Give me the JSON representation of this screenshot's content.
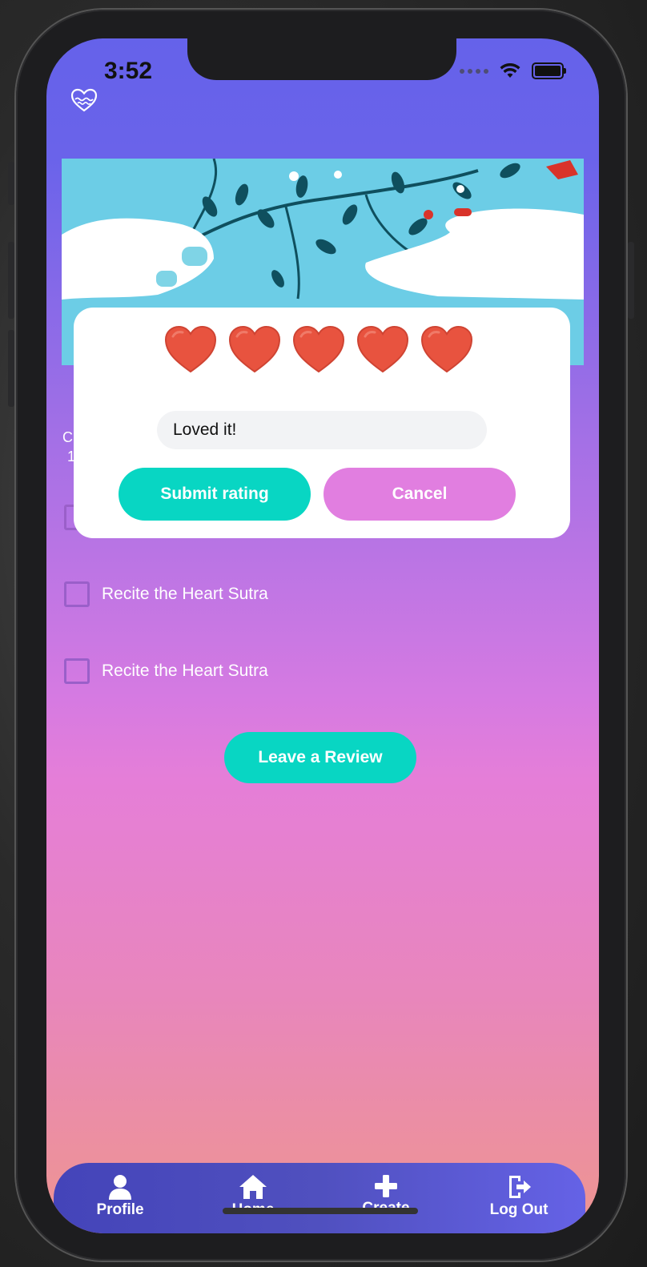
{
  "status_bar": {
    "time": "3:52"
  },
  "colors": {
    "accent_teal": "#08d6c3",
    "cancel_pink": "#e17ee0",
    "heart_red": "#e8533f",
    "tabbar_start": "#4444b9",
    "tabbar_end": "#6562e6"
  },
  "header": {
    "icon": "heart-wave-icon"
  },
  "banner": {
    "image": "hands-with-leafy-vine-illustration"
  },
  "background_peek": {
    "line1": "C",
    "line2": "1"
  },
  "tasks": [
    {
      "label": "Recite the Heart Sutra",
      "checked": false
    },
    {
      "label": "Recite the Heart Sutra",
      "checked": false
    }
  ],
  "review_button": {
    "label": "Leave a Review"
  },
  "rating_modal": {
    "rating": 5,
    "max_rating": 5,
    "comment_value": "Loved it!",
    "submit_label": "Submit rating",
    "cancel_label": "Cancel"
  },
  "tabbar": {
    "items": [
      {
        "label": "Profile",
        "icon": "person-icon"
      },
      {
        "label": "Home",
        "icon": "home-icon"
      },
      {
        "label": "Create",
        "icon": "plus-icon"
      },
      {
        "label": "Log Out",
        "icon": "logout-icon"
      }
    ]
  }
}
